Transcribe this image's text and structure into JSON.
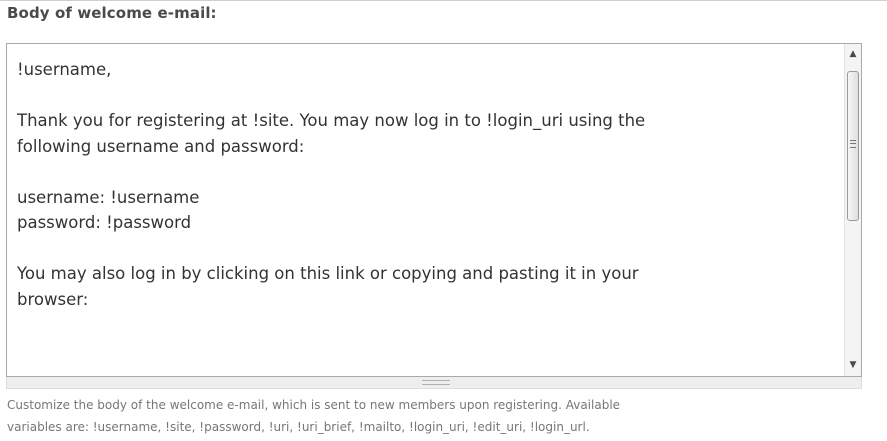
{
  "field": {
    "label": "Body of welcome e-mail:",
    "body_text": "!username,\n\nThank you for registering at !site. You may now log in to !login_uri using the\nfollowing username and password:\n\nusername: !username\npassword: !password\n\nYou may also log in by clicking on this link or copying and pasting it in your\nbrowser:",
    "description_line1": "Customize the body of the welcome e-mail, which is sent to new members upon registering. Available",
    "description_line2": "variables are: !username, !site, !password, !uri, !uri_brief, !mailto, !login_uri, !edit_uri, !login_url."
  },
  "scrollbar": {
    "up_icon": "arrow-up-icon",
    "down_icon": "arrow-down-icon",
    "position": 0
  }
}
